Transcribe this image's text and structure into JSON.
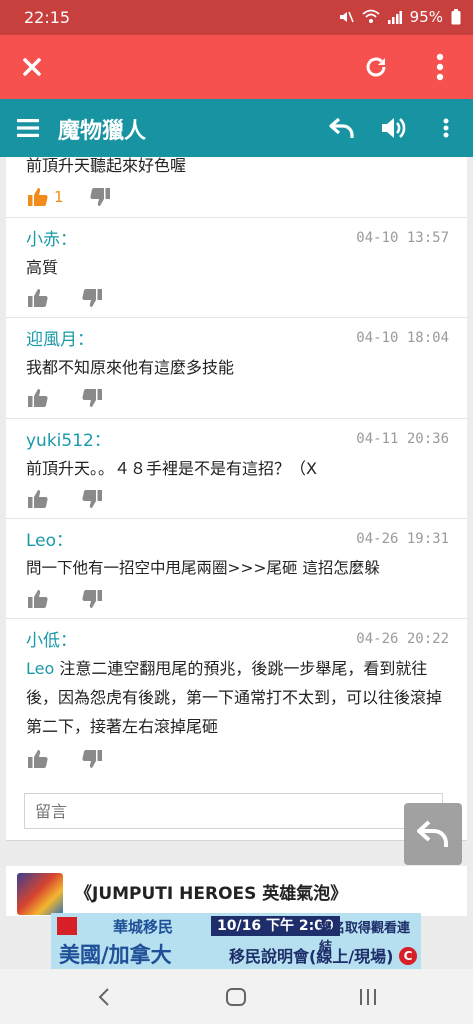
{
  "status_bar": {
    "time": "22:15",
    "battery": "95%"
  },
  "toolbar": {
    "close_icon": "close-icon",
    "refresh_icon": "refresh-icon",
    "more_icon": "more-vertical-icon"
  },
  "header": {
    "title": "魔物獵人"
  },
  "comments": [
    {
      "text": "前頂升天聽起來好色喔",
      "likes": "1"
    },
    {
      "name": "小赤：",
      "date": "04-10 13:57",
      "text": "高質"
    },
    {
      "name": "迎風月：",
      "date": "04-10 18:04",
      "text": "我都不知原來他有這麼多技能"
    },
    {
      "name": "yuki512：",
      "date": "04-11 20:36",
      "text": "前頂升天。。４８手裡是不是有這招？（X"
    },
    {
      "name": "Leo：",
      "date": "04-26 19:31",
      "text": "問一下他有一招空中甩尾兩圈>>>尾砸 這招怎麼躲"
    },
    {
      "name": "小低：",
      "date": "04-26 20:22",
      "mention": "Leo",
      "text": " 注意二連空翻甩尾的預兆，後跳一步舉尾，看到就往後，因為怨虎有後跳，第一下通常打不太到，可以往後滾掉第二下，接著左右滾掉尾砸"
    }
  ],
  "reply": {
    "placeholder": "留言"
  },
  "game": {
    "title": "《JUMPUTI HEROES 英雄氣泡》"
  },
  "ad": {
    "brand": "華城移民",
    "date": "10/16 下午 2:00",
    "cta": "報名取得觀看連結",
    "headline": "美國/加拿大",
    "subline": "移民說明會(線上/現場)",
    "badge": "C"
  },
  "colors": {
    "status": "#c7403e",
    "toolbar": "#f6504f",
    "header": "#1893a2",
    "accent": "#1a9aa8",
    "like": "#f08c1c"
  }
}
